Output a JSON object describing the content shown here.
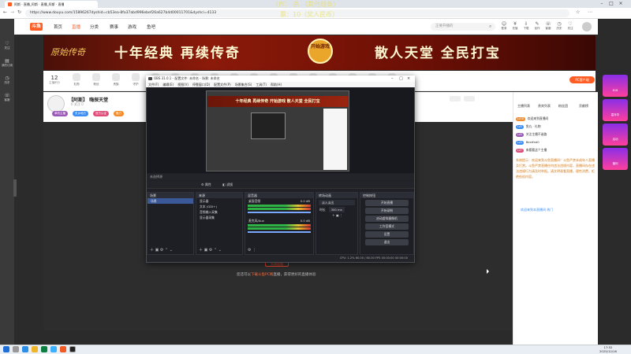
{
  "browser": {
    "tab_title": "阿斯 · 直播_阿斯 · 直播_阿斯 · 直播",
    "url": "https://www.douyu.com/15896267dyshid=cb53ea-8fa37abd996ebef26a627b4d00011701&dyshci=4133",
    "search_placeholder": "正要开播的"
  },
  "overlay": {
    "line1": "（作： 杀 （其他线条）",
    "line2": "票：10（奖人民币）"
  },
  "left_strip": [
    "关注",
    "我的订阅",
    "历史",
    "客服"
  ],
  "site": {
    "logo": "斗鱼",
    "nav": [
      "首页",
      "直播",
      "分类",
      "赛事",
      "游戏",
      "鱼吧"
    ],
    "top_icons": [
      "登录",
      "充值",
      "下载",
      "创作",
      "客服",
      "历史",
      "关注"
    ]
  },
  "banner": {
    "left_logo": "原始传奇",
    "text_left": "十年经典 再续传奇",
    "badge": "开始游戏",
    "text_right": "散人天堂 全民打宝"
  },
  "gift_bar": {
    "count": "12",
    "count_label": "主播积分",
    "items": [
      "礼物",
      "粉丝",
      "贵族",
      "守护",
      "活动",
      "等级",
      "分享",
      "客户端",
      "主播",
      "弹幕",
      "红包",
      "录像",
      "小程序",
      "主播之家",
      "云游戏",
      "商城",
      "直播间"
    ],
    "pc_button": "PC客户端"
  },
  "streamer": {
    "title": "【阿斯】 嗨探天堂",
    "followers": "0  关注  0",
    "tags": [
      "单机主播",
      "东乡地方",
      "官方认证",
      "魅力"
    ]
  },
  "video": {
    "live_button": "开始直播",
    "hint_prefix": "您还可以",
    "hint_link": "下载斗鱼PC端",
    "hint_suffix": "直播，获得更好的直播体验"
  },
  "chat": {
    "tabs": [
      "主播列表",
      "贵宾列表",
      "粉丝团",
      "贡献榜"
    ],
    "lines": [
      {
        "tag": "Lv18",
        "text": "欢迎来到直播间",
        "color": "#f28b2c"
      },
      {
        "tag": "Lv5",
        "text": "鱼丸 · 礼物",
        "color": "#3a8ef6"
      },
      {
        "tag": "Lv9",
        "text": "关注主播不迷路",
        "color": "#9b59b6"
      },
      {
        "tag": "Lv3",
        "text": "Bestfed0",
        "color": "#3a8ef6"
      },
      {
        "tag": "Lv7",
        "text": "来看看这个主播",
        "color": "#e04d7a"
      }
    ],
    "notice": "系统提示：欢迎来到斗鱼直播间！斗鱼严禁未成年人直播及打赏。斗鱼严禁直播任何违法违规内容，直播间存在违法违规行为请及时举报。请文明观看直播，理性消费，拒绝低俗内容。",
    "footer": "欢迎来到本直播间  热门"
  },
  "right_ads": [
    "618",
    "嘉年华",
    "活动",
    "福利"
  ],
  "obs": {
    "title": "OBS 31.0.1 - 配置文件: 未命名 - 场景: 未命名",
    "menu": [
      "文件(F)",
      "编辑(E)",
      "视图(V)",
      "停靠窗口(D)",
      "配置文件(P)",
      "场景集合(S)",
      "工具(T)",
      "帮助(H)"
    ],
    "preview_banner": "十年经典 再续传奇 开始游戏 散人天堂 全民打宝",
    "source_bar": "未选择源",
    "props": [
      "属性",
      "滤镜"
    ],
    "scenes_title": "场景",
    "scenes": [
      "场景"
    ],
    "sources_title": "来源",
    "sources": [
      "显示器",
      "文本 (GDI+)",
      "音频输入采集",
      "显示器采集"
    ],
    "mixer_title": "混音器",
    "mixer": [
      {
        "name": "桌面音频",
        "level": "0.0 dB"
      },
      {
        "name": "麦克风/Aux",
        "level": "0.0 dB"
      }
    ],
    "transitions_title": "转场动画",
    "transition_type": "淡入淡出",
    "transition_duration_label": "时长",
    "transition_duration": "300 ms",
    "controls_title": "控制按钮",
    "controls": [
      "开始直播",
      "开始录制",
      "启动虚拟摄像机",
      "工作室模式",
      "设置",
      "退出"
    ],
    "status": "CPU: 1.2%    60.00 / 60.00 FPS    00:00:00    00:00:00"
  },
  "taskbar": {
    "time": "17:52",
    "date": "2025/12/16"
  }
}
